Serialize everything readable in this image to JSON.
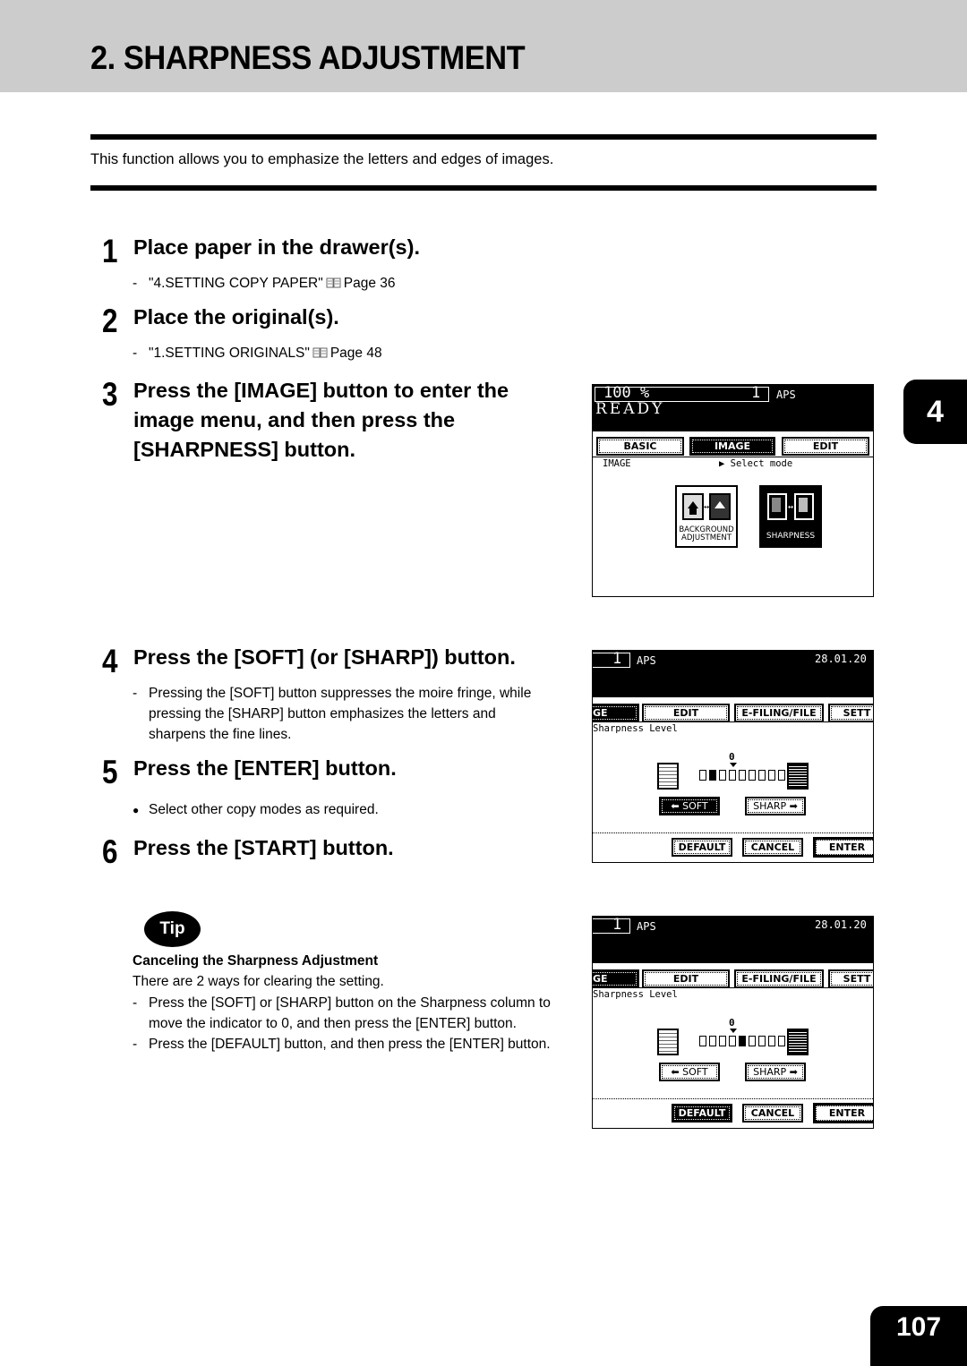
{
  "header": {
    "title": "2. SHARPNESS ADJUSTMENT"
  },
  "intro": "This function allows you to emphasize the letters and edges of images.",
  "chapter_tab": "4",
  "page_number": "107",
  "steps": [
    {
      "num": "1",
      "title": "Place paper in the drawer(s).",
      "note": "\"4.SETTING COPY PAPER\"",
      "page_ref": "Page 36"
    },
    {
      "num": "2",
      "title": "Place the original(s).",
      "note": "\"1.SETTING ORIGINALS\"",
      "page_ref": "Page 48"
    },
    {
      "num": "3",
      "title_lines": [
        "Press the [IMAGE] button to enter the",
        "image menu, and then press the",
        "[SHARPNESS] button."
      ]
    },
    {
      "num": "4",
      "title": "Press the [SOFT] (or [SHARP]) button.",
      "note_lines": [
        "Pressing the [SOFT] button suppresses the moire fringe, while",
        "pressing the [SHARP] button emphasizes the letters and",
        "sharpens the fine lines."
      ]
    },
    {
      "num": "5",
      "title": "Press the [ENTER] button.",
      "bullet": "Select other copy modes as required."
    },
    {
      "num": "6",
      "title": "Press the [START] button."
    }
  ],
  "tip": {
    "badge": "Tip",
    "title": "Canceling the Sharpness Adjustment",
    "intro": "There are 2 ways for clearing the setting.",
    "items": [
      [
        "Press the [SOFT] or [SHARP] button on the Sharpness column to",
        "move the indicator to 0, and then press the [ENTER] button."
      ],
      [
        "Press the [DEFAULT] button, and then press the [ENTER] button."
      ]
    ]
  },
  "screens": {
    "image_menu": {
      "zoom": "100  %",
      "copies": "1",
      "paper": "APS",
      "status": "READY",
      "tabs": [
        "BASIC",
        "IMAGE",
        "EDIT"
      ],
      "active_tab": "IMAGE",
      "crumb": "IMAGE",
      "hint": "▶ Select mode",
      "buttons": [
        {
          "label_lines": [
            "BACKGROUND",
            "ADJUSTMENT"
          ],
          "selected": false
        },
        {
          "label_lines": [
            "SHARPNESS"
          ],
          "selected": true
        }
      ]
    },
    "sharpness_soft": {
      "copies": "1",
      "paper": "APS",
      "date": "28.01.20",
      "tabs": [
        "GE",
        "EDIT",
        "E-FILING/FILE",
        "SETT"
      ],
      "label": "Sharpness Level",
      "zero_label": "0",
      "level": -3,
      "level_min": -4,
      "level_max": 4,
      "soft": "⬅ SOFT",
      "sharp": "SHARP ➡",
      "footer": [
        "DEFAULT",
        "CANCEL",
        "ENTER"
      ],
      "soft_pressed": true,
      "default_pressed": false
    },
    "sharpness_default": {
      "copies": "1",
      "paper": "APS",
      "date": "28.01.20",
      "tabs": [
        "GE",
        "EDIT",
        "E-FILING/FILE",
        "SETT"
      ],
      "label": "Sharpness Level",
      "zero_label": "0",
      "level": 0,
      "level_min": -4,
      "level_max": 4,
      "soft": "⬅ SOFT",
      "sharp": "SHARP ➡",
      "footer": [
        "DEFAULT",
        "CANCEL",
        "ENTER"
      ],
      "soft_pressed": false,
      "default_pressed": true
    }
  }
}
